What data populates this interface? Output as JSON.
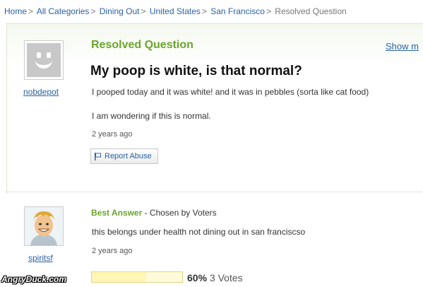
{
  "breadcrumb": {
    "items": [
      "Home",
      "All Categories",
      "Dining Out",
      "United States",
      "San Francisco"
    ],
    "current": "Resolved Question",
    "separator": ">"
  },
  "question": {
    "status": "Resolved Question",
    "show_more": "Show m",
    "title": "My poop is white, is that normal?",
    "body_line1": "I pooped today and it was white! and it was in pebbles (sorta like cat food)",
    "body_line2": "I am wondering if this is normal.",
    "time": "2 years ago",
    "report_label": "Report Abuse",
    "asker": "nobdepot",
    "avatar_icon": "default-smiley-avatar-icon"
  },
  "answer": {
    "label": "Best Answer",
    "chosen_by": " - Chosen by Voters",
    "body": "this belongs under health not dining out in san franciscso",
    "time": "2 years ago",
    "answerer": "spiritsf",
    "avatar_icon": "cartoon-man-avatar-icon",
    "vote_percent": "60%",
    "vote_fraction": 0.6,
    "votes": "3 Votes"
  },
  "watermark": "AngryDuck.com",
  "colors": {
    "link": "#2a62a3",
    "accent_green": "#6aa52b",
    "vote_bar": "#fff6b6"
  }
}
